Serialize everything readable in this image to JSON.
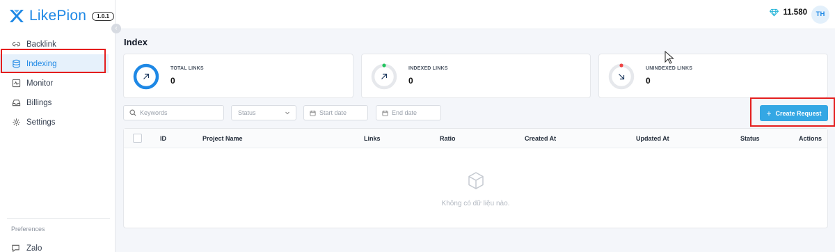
{
  "app": {
    "logo_name": "LikePion",
    "version": "1.0.1",
    "accent": "#1e88e5"
  },
  "sidebar": {
    "items": [
      {
        "label": "Backlink",
        "icon": "link-icon"
      },
      {
        "label": "Indexing",
        "icon": "database-icon",
        "active": true
      },
      {
        "label": "Monitor",
        "icon": "pulse-icon"
      },
      {
        "label": "Billings",
        "icon": "inbox-icon"
      },
      {
        "label": "Settings",
        "icon": "gear-icon"
      }
    ],
    "preferences_label": "Preferences",
    "zalo_label": "Zalo"
  },
  "header": {
    "credits": "11.580",
    "avatar_initials": "TH"
  },
  "page": {
    "title": "Index"
  },
  "stats": [
    {
      "label": "TOTAL LINKS",
      "value": "0",
      "color": "#1e88e5"
    },
    {
      "label": "INDEXED LINKS",
      "value": "0",
      "color": "#22c55e"
    },
    {
      "label": "UNINDEXED LINKS",
      "value": "0",
      "color": "#ef4444"
    }
  ],
  "filters": {
    "keywords_placeholder": "Keywords",
    "status_placeholder": "Status",
    "start_date_placeholder": "Start date",
    "end_date_placeholder": "End date"
  },
  "create_button_label": "Create Request",
  "table": {
    "columns": [
      "ID",
      "Project Name",
      "Links",
      "Ratio",
      "Created At",
      "Updated At",
      "Status",
      "Actions"
    ],
    "rows": [],
    "empty_text": "Không có dữ liệu nào."
  }
}
